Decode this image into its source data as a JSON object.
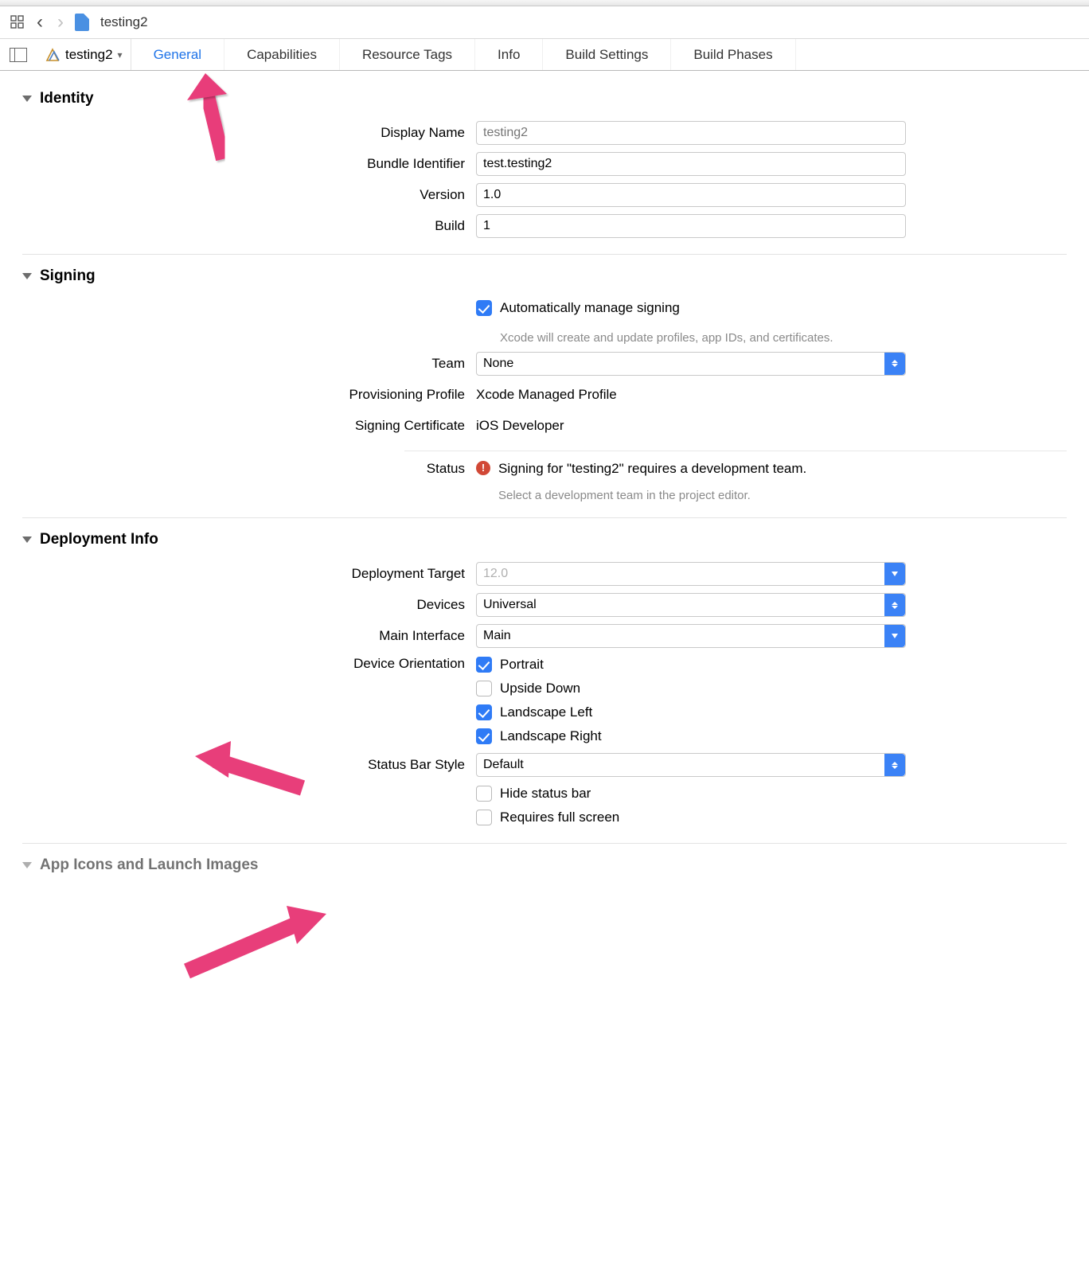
{
  "toolbar": {
    "breadcrumb": "testing2",
    "target_name": "testing2"
  },
  "tabs": [
    {
      "label": "General",
      "active": true
    },
    {
      "label": "Capabilities",
      "active": false
    },
    {
      "label": "Resource Tags",
      "active": false
    },
    {
      "label": "Info",
      "active": false
    },
    {
      "label": "Build Settings",
      "active": false
    },
    {
      "label": "Build Phases",
      "active": false
    }
  ],
  "identity": {
    "title": "Identity",
    "display_name_label": "Display Name",
    "display_name_placeholder": "testing2",
    "display_name_value": "",
    "bundle_id_label": "Bundle Identifier",
    "bundle_id_value": "test.testing2",
    "version_label": "Version",
    "version_value": "1.0",
    "build_label": "Build",
    "build_value": "1"
  },
  "signing": {
    "title": "Signing",
    "auto_label": "Automatically manage signing",
    "auto_checked": true,
    "auto_note": "Xcode will create and update profiles, app IDs, and certificates.",
    "team_label": "Team",
    "team_value": "None",
    "profile_label": "Provisioning Profile",
    "profile_value": "Xcode Managed Profile",
    "cert_label": "Signing Certificate",
    "cert_value": "iOS Developer",
    "status_label": "Status",
    "status_msg": "Signing for \"testing2\" requires a development team.",
    "status_note": "Select a development team in the project editor."
  },
  "deployment": {
    "title": "Deployment Info",
    "target_label": "Deployment Target",
    "target_value": "12.0",
    "devices_label": "Devices",
    "devices_value": "Universal",
    "main_interface_label": "Main Interface",
    "main_interface_value": "Main",
    "orientation_label": "Device Orientation",
    "orientations": [
      {
        "label": "Portrait",
        "checked": true
      },
      {
        "label": "Upside Down",
        "checked": false
      },
      {
        "label": "Landscape Left",
        "checked": true
      },
      {
        "label": "Landscape Right",
        "checked": true
      }
    ],
    "statusbar_label": "Status Bar Style",
    "statusbar_value": "Default",
    "hide_statusbar_label": "Hide status bar",
    "hide_statusbar_checked": false,
    "fullscreen_label": "Requires full screen",
    "fullscreen_checked": false
  },
  "next_section_title": "App Icons and Launch Images"
}
